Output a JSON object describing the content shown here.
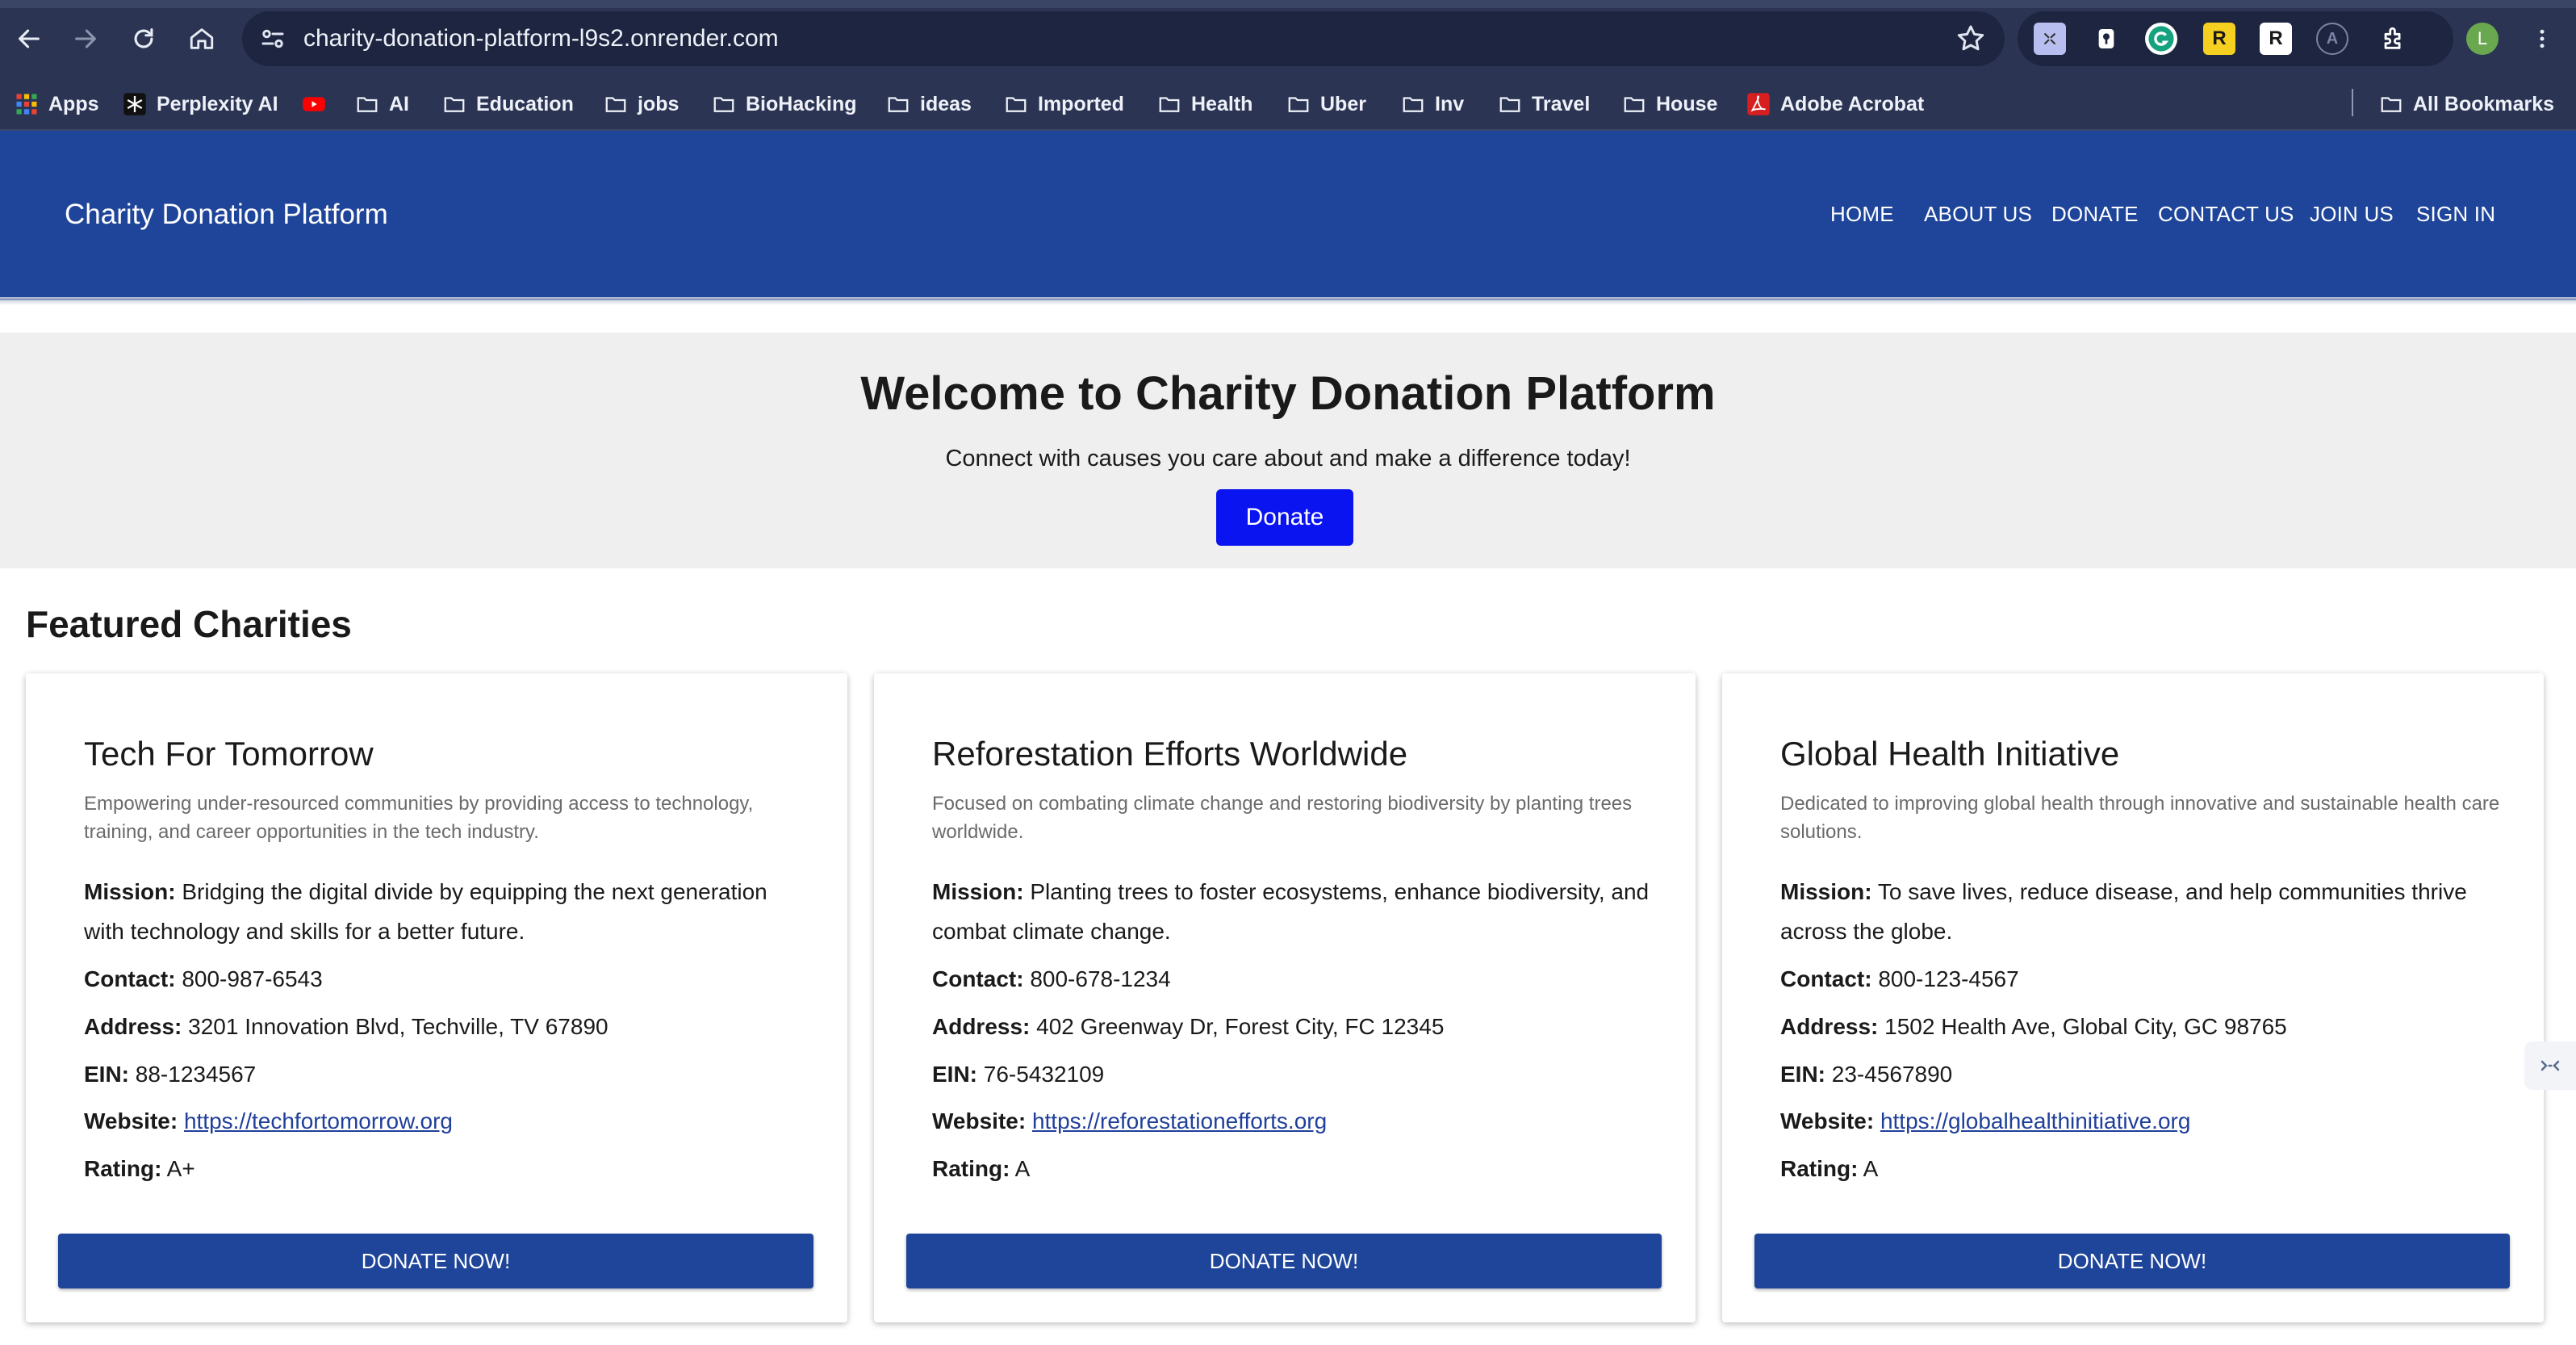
{
  "browser": {
    "url": "charity-donation-platform-l9s2.onrender.com",
    "icons": [
      "back-icon",
      "forward-icon",
      "reload-icon",
      "home-icon",
      "site-settings-icon",
      "bookmark-star-icon",
      "extensions-icon",
      "kebab-menu-icon"
    ],
    "profile_initial": "L",
    "extensions": [
      "R",
      "R",
      "A"
    ]
  },
  "bookmarks": {
    "items": [
      "Apps",
      "Perplexity AI",
      "AI",
      "Education",
      "jobs",
      "BioHacking",
      "ideas",
      "Imported",
      "Health",
      "Uber",
      "Inv",
      "Travel",
      "House",
      "Adobe Acrobat"
    ],
    "all_bookmarks": "All Bookmarks"
  },
  "site": {
    "brand": "Charity Donation Platform",
    "nav": [
      "HOME",
      "ABOUT US",
      "DONATE",
      "CONTACT US",
      "JOIN US",
      "SIGN IN"
    ],
    "header_color": "#1f459a"
  },
  "hero": {
    "title": "Welcome to Charity Donation Platform",
    "subtitle": "Connect with causes you care about and make a difference today!",
    "button": "Donate",
    "button_color": "#0a14f0"
  },
  "featured": {
    "title": "Featured Charities",
    "labels": {
      "mission": "Mission:",
      "contact": "Contact:",
      "address": "Address:",
      "ein": "EIN:",
      "website": "Website:",
      "rating": "Rating:"
    },
    "button": "DONATE NOW!",
    "charities": [
      {
        "name": "Tech For Tomorrow",
        "description": "Empowering under-resourced communities by providing access to technology, training, and career opportunities in the tech industry.",
        "mission": "Bridging the digital divide by equipping the next generation with technology and skills for a better future.",
        "contact": "800-987-6543",
        "address": "3201 Innovation Blvd, Techville, TV 67890",
        "ein": "88-1234567",
        "website": "https://techfortomorrow.org",
        "rating": "A+"
      },
      {
        "name": "Reforestation Efforts Worldwide",
        "description": "Focused on combating climate change and restoring biodiversity by planting trees worldwide.",
        "mission": "Planting trees to foster ecosystems, enhance biodiversity, and combat climate change.",
        "contact": "800-678-1234",
        "address": "402 Greenway Dr, Forest City, FC 12345",
        "ein": "76-5432109",
        "website": "https://reforestationefforts.org",
        "rating": "A"
      },
      {
        "name": "Global Health Initiative",
        "description": "Dedicated to improving global health through innovative and sustainable health care solutions.",
        "mission": "To save lives, reduce disease, and help communities thrive across the globe.",
        "contact": "800-123-4567",
        "address": "1502 Health Ave, Global City, GC 98765",
        "ein": "23-4567890",
        "website": "https://globalhealthinitiative.org",
        "rating": "A"
      }
    ]
  }
}
